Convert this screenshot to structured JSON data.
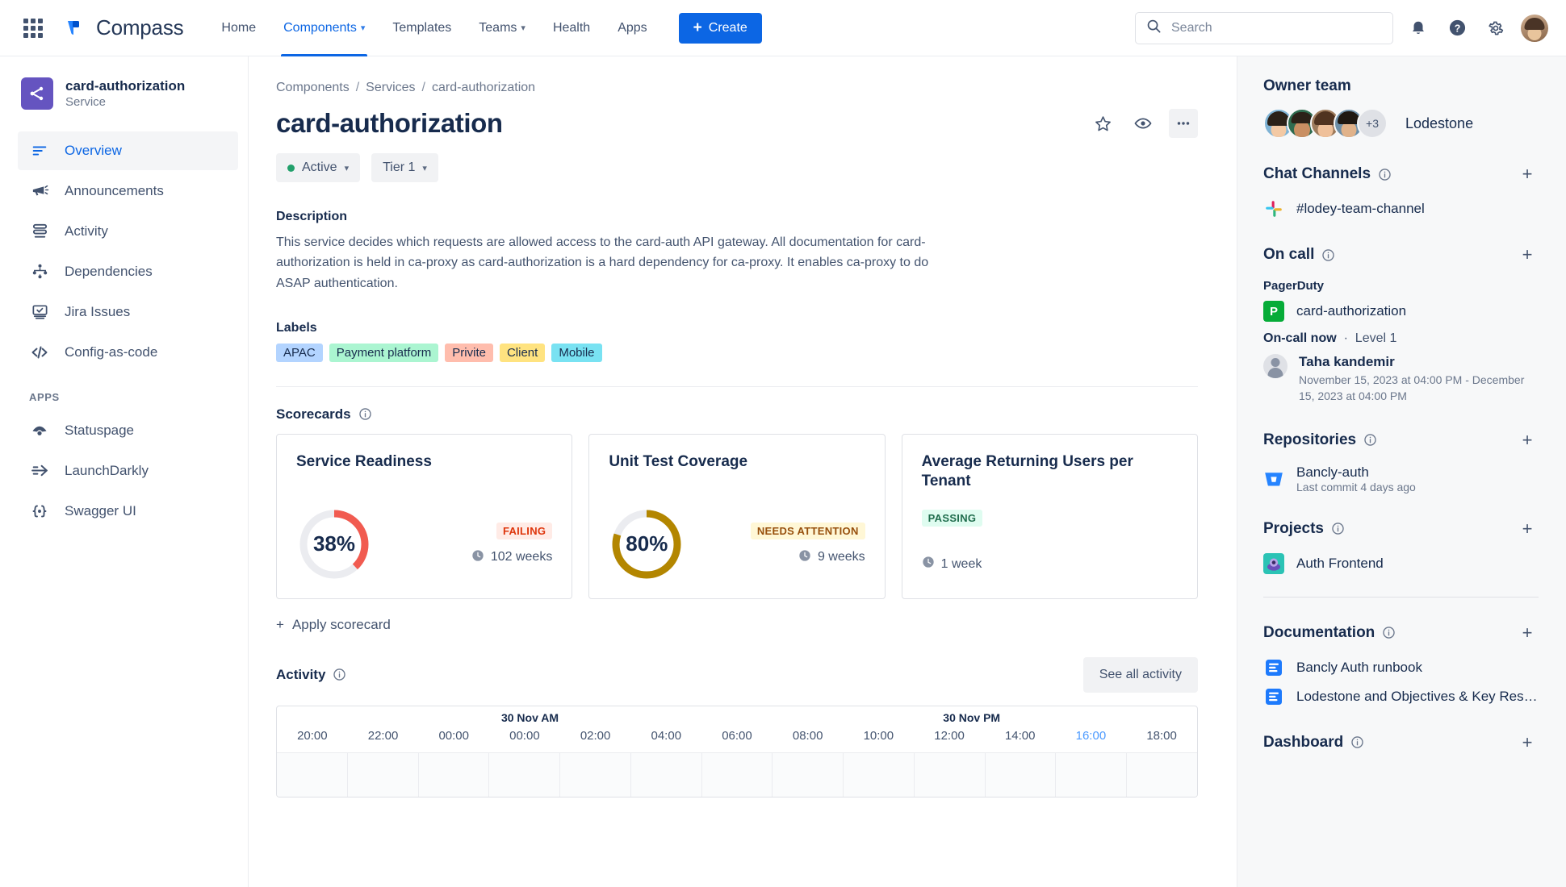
{
  "topnav": {
    "brand": "Compass",
    "links": [
      {
        "label": "Home",
        "active": false,
        "caret": false
      },
      {
        "label": "Components",
        "active": true,
        "caret": true
      },
      {
        "label": "Templates",
        "active": false,
        "caret": false
      },
      {
        "label": "Teams",
        "active": false,
        "caret": true
      },
      {
        "label": "Health",
        "active": false,
        "caret": false
      },
      {
        "label": "Apps",
        "active": false,
        "caret": false
      }
    ],
    "create_label": "Create",
    "search_placeholder": "Search",
    "search_value": "",
    "icons": [
      "notifications-icon",
      "help-icon",
      "settings-icon",
      "profile-avatar"
    ]
  },
  "sidebar": {
    "component_name": "card-authorization",
    "component_type": "Service",
    "items": [
      {
        "label": "Overview",
        "icon": "overview-icon",
        "active": true
      },
      {
        "label": "Announcements",
        "icon": "megaphone-icon",
        "active": false
      },
      {
        "label": "Activity",
        "icon": "activity-icon",
        "active": false
      },
      {
        "label": "Dependencies",
        "icon": "dependencies-icon",
        "active": false
      },
      {
        "label": "Jira Issues",
        "icon": "jira-icon",
        "active": false
      },
      {
        "label": "Config-as-code",
        "icon": "code-icon",
        "active": false
      }
    ],
    "apps_section": "APPS",
    "apps": [
      {
        "label": "Statuspage",
        "icon": "statuspage-icon"
      },
      {
        "label": "LaunchDarkly",
        "icon": "launchdarkly-icon"
      },
      {
        "label": "Swagger UI",
        "icon": "swagger-icon"
      }
    ]
  },
  "main": {
    "breadcrumb": [
      "Components",
      "Services",
      "card-authorization"
    ],
    "title": "card-authorization",
    "status_chip": "Active",
    "tier_chip": "Tier 1",
    "description_heading": "Description",
    "description": "This service decides which requests are allowed access to the card-auth API gateway. All documentation for card-authorization is held in ca-proxy as card-authorization is a hard dependency for ca-proxy. It enables ca-proxy to do ASAP authentication.",
    "labels_heading": "Labels",
    "labels": [
      {
        "text": "APAC",
        "bg": "#B3D4FF",
        "fg": "#172B4D"
      },
      {
        "text": "Payment platform",
        "bg": "#ABF5D1",
        "fg": "#172B4D"
      },
      {
        "text": "Privite",
        "bg": "#FFBDAD",
        "fg": "#172B4D"
      },
      {
        "text": "Client",
        "bg": "#FFE380",
        "fg": "#172B4D"
      },
      {
        "text": "Mobile",
        "bg": "#79E2F2",
        "fg": "#172B4D"
      }
    ],
    "scorecards_heading": "Scorecards",
    "scorecards": [
      {
        "title": "Service Readiness",
        "score": "38%",
        "percent": 38,
        "status": "FAILING",
        "status_bg": "#FFEBE6",
        "status_fg": "#DE350B",
        "ring_color": "#F15B50",
        "age": "102 weeks",
        "has_score": true
      },
      {
        "title": "Unit Test Coverage",
        "score": "80%",
        "percent": 80,
        "status": "NEEDS ATTENTION",
        "status_bg": "#FFF7D6",
        "status_fg": "#974F0C",
        "ring_color": "#B38600",
        "age": "9 weeks",
        "has_score": true
      },
      {
        "title": "Average Returning Users per Tenant",
        "score": "",
        "percent": 0,
        "status": "PASSING",
        "status_bg": "#DFFCF0",
        "status_fg": "#216E4E",
        "ring_color": "#22A06B",
        "age": "1 week",
        "has_score": false
      }
    ],
    "apply_scorecard": "Apply scorecard",
    "activity_heading": "Activity",
    "see_all_activity": "See all activity",
    "timeline": {
      "day_labels": [
        {
          "text": "30 Nov AM",
          "left_pct": 27.5
        },
        {
          "text": "30 Nov PM",
          "left_pct": 75.5
        }
      ],
      "ticks": [
        "20:00",
        "22:00",
        "00:00",
        "00:00",
        "02:00",
        "04:00",
        "06:00",
        "08:00",
        "10:00",
        "12:00",
        "14:00",
        "16:00",
        "18:00"
      ],
      "highlight_tick": "16:00"
    }
  },
  "right": {
    "owner_team_heading": "Owner team",
    "owner_team_name": "Lodestone",
    "owner_team_overflow": "+3",
    "chat_heading": "Chat Channels",
    "chat_channel": "#lodey-team-channel",
    "oncall_heading": "On call",
    "oncall_provider": "PagerDuty",
    "oncall_service": "card-authorization",
    "oncall_badge_letter": "P",
    "oncall_now_label": "On-call now",
    "oncall_level": "Level 1",
    "oncall_person": "Taha kandemir",
    "oncall_period": "November 15, 2023 at 04:00 PM - December 15, 2023 at 04:00 PM",
    "repos_heading": "Repositories",
    "repo_name": "Bancly-auth",
    "repo_sub": "Last commit 4 days ago",
    "projects_heading": "Projects",
    "project_name": "Auth Frontend",
    "docs_heading": "Documentation",
    "docs": [
      "Bancly Auth runbook",
      "Lodestone and Objectives & Key Resul..."
    ],
    "dashboard_heading": "Dashboard",
    "add_label": "+"
  }
}
